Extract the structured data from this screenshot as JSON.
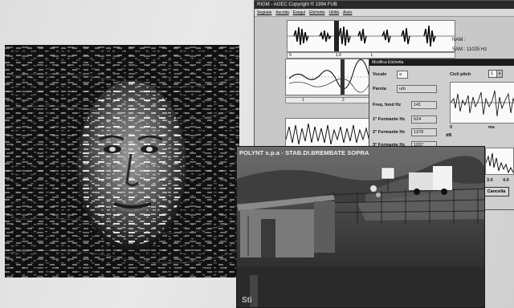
{
  "app": {
    "title": "RIGM - AGEC   Copyright © 1994 FUB",
    "menu": [
      "Segnale",
      "Ascolta",
      "Esegui",
      "Etichette",
      "Utilità",
      "Aiuto"
    ],
    "info_nam": "NAM :",
    "info_sam": "SAM : 11025 Hz",
    "ruler_left": "0",
    "ruler_mid": "1.0",
    "ruler_mark": "L",
    "mini_left": "1",
    "mini_right": "2"
  },
  "dialog": {
    "title": "Modifica Etichetta",
    "fields": [
      {
        "label": "Vocale",
        "value": "a"
      },
      {
        "label": "Parola",
        "value": "urb"
      },
      {
        "label": "Freq. fond Hz",
        "value": "141"
      },
      {
        "label": "1° Formante Hz",
        "value": "624"
      },
      {
        "label": "2° Formante Hz",
        "value": "1378"
      },
      {
        "label": "3° Formante Hz",
        "value": "1937"
      }
    ],
    "pitch_label": "Cicli pitch",
    "pitch_value": "1",
    "axis_left": "0",
    "axis_unit": "ms",
    "db_label": "dB",
    "freq_ticks": [
      "3.0",
      "4.0"
    ],
    "cancel_label": "Cancella"
  },
  "cctv": {
    "caption": "POLYNT s.p.a - STAB.DI.BREMBATE SOPRA",
    "sign_text": "Sti"
  }
}
